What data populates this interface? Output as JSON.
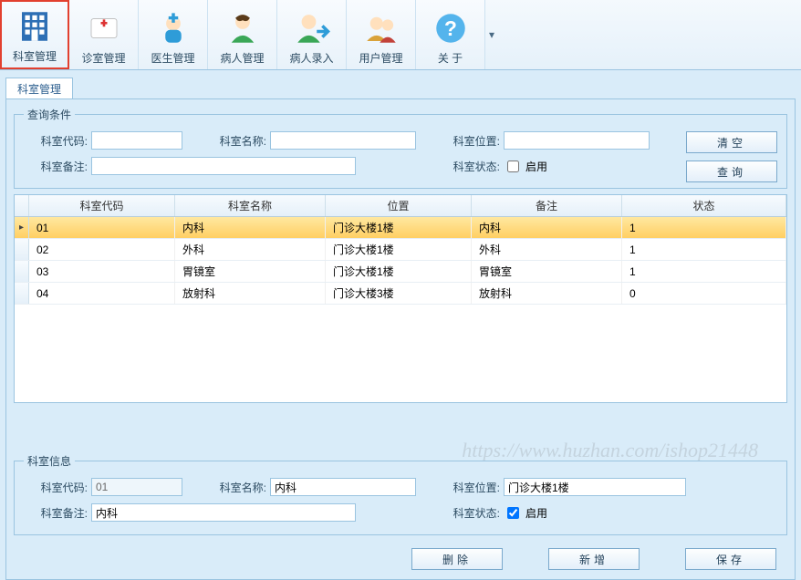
{
  "toolbar": [
    {
      "label": "科室管理",
      "icon": "building",
      "active": true
    },
    {
      "label": "诊室管理",
      "icon": "clinic"
    },
    {
      "label": "医生管理",
      "icon": "doctor"
    },
    {
      "label": "病人管理",
      "icon": "patient"
    },
    {
      "label": "病人录入",
      "icon": "entry"
    },
    {
      "label": "用户管理",
      "icon": "users"
    },
    {
      "label": "关 于",
      "icon": "help"
    }
  ],
  "tab": {
    "label": "科室管理"
  },
  "query": {
    "legend": "查询条件",
    "code_label": "科室代码:",
    "name_label": "科室名称:",
    "loc_label": "科室位置:",
    "note_label": "科室备注:",
    "status_label": "科室状态:",
    "enable_text": "启用",
    "clear_btn": "清空",
    "search_btn": "查询",
    "code_val": "",
    "name_val": "",
    "loc_val": "",
    "note_val": ""
  },
  "grid": {
    "headers": {
      "code": "科室代码",
      "name": "科室名称",
      "loc": "位置",
      "note": "备注",
      "status": "状态"
    },
    "rows": [
      {
        "code": "01",
        "name": "内科",
        "loc": "门诊大楼1楼",
        "note": "内科",
        "status": "1",
        "selected": true
      },
      {
        "code": "02",
        "name": "外科",
        "loc": "门诊大楼1楼",
        "note": "外科",
        "status": "1"
      },
      {
        "code": "03",
        "name": "胃镜室",
        "loc": "门诊大楼1楼",
        "note": "胃镜室",
        "status": "1"
      },
      {
        "code": "04",
        "name": "放射科",
        "loc": "门诊大楼3楼",
        "note": "放射科",
        "status": "0"
      }
    ]
  },
  "info": {
    "legend": "科室信息",
    "code_label": "科室代码:",
    "name_label": "科室名称:",
    "loc_label": "科室位置:",
    "note_label": "科室备注:",
    "status_label": "科室状态:",
    "enable_text": "启用",
    "code_val": "01",
    "name_val": "内科",
    "loc_val": "门诊大楼1楼",
    "note_val": "内科",
    "enabled": true
  },
  "actions": {
    "delete": "删除",
    "add": "新增",
    "save": "保存"
  },
  "watermark": "https://www.huzhan.com/ishop21448"
}
